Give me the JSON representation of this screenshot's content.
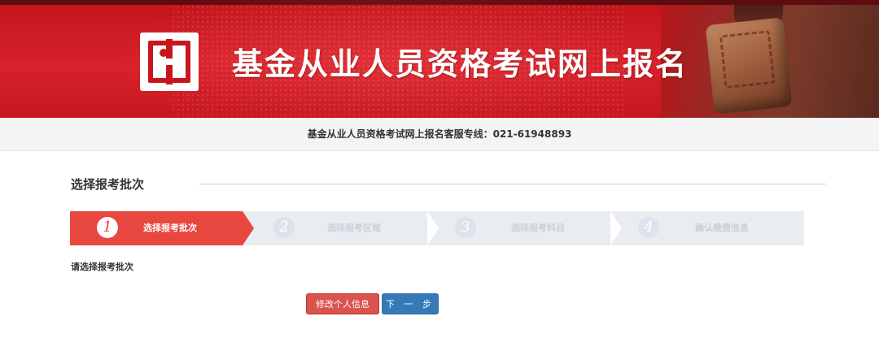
{
  "banner": {
    "title": "基金从业人员资格考试网上报名",
    "colors": {
      "primary": "#c8161e",
      "dark": "#5d0c10"
    }
  },
  "hotline": {
    "text": "基金从业人员资格考试网上报名客服专线：021-61948893"
  },
  "section": {
    "title": "选择报考批次"
  },
  "steps": [
    {
      "number": "1",
      "label": "选择报考批次",
      "state": "active"
    },
    {
      "number": "2",
      "label": "选择报考区域",
      "state": "inactive"
    },
    {
      "number": "3",
      "label": "选择报考科目",
      "state": "inactive"
    },
    {
      "number": "4",
      "label": "确认缴费信息",
      "state": "inactive"
    }
  ],
  "prompt": "请选择报考批次",
  "buttons": {
    "edit_profile": "修改个人信息",
    "next": "下 一 步"
  },
  "colors": {
    "active_step": "#e8473f",
    "inactive_step_bg": "#e9edf2",
    "danger_button": "#d9534f",
    "primary_button": "#337ab7"
  }
}
